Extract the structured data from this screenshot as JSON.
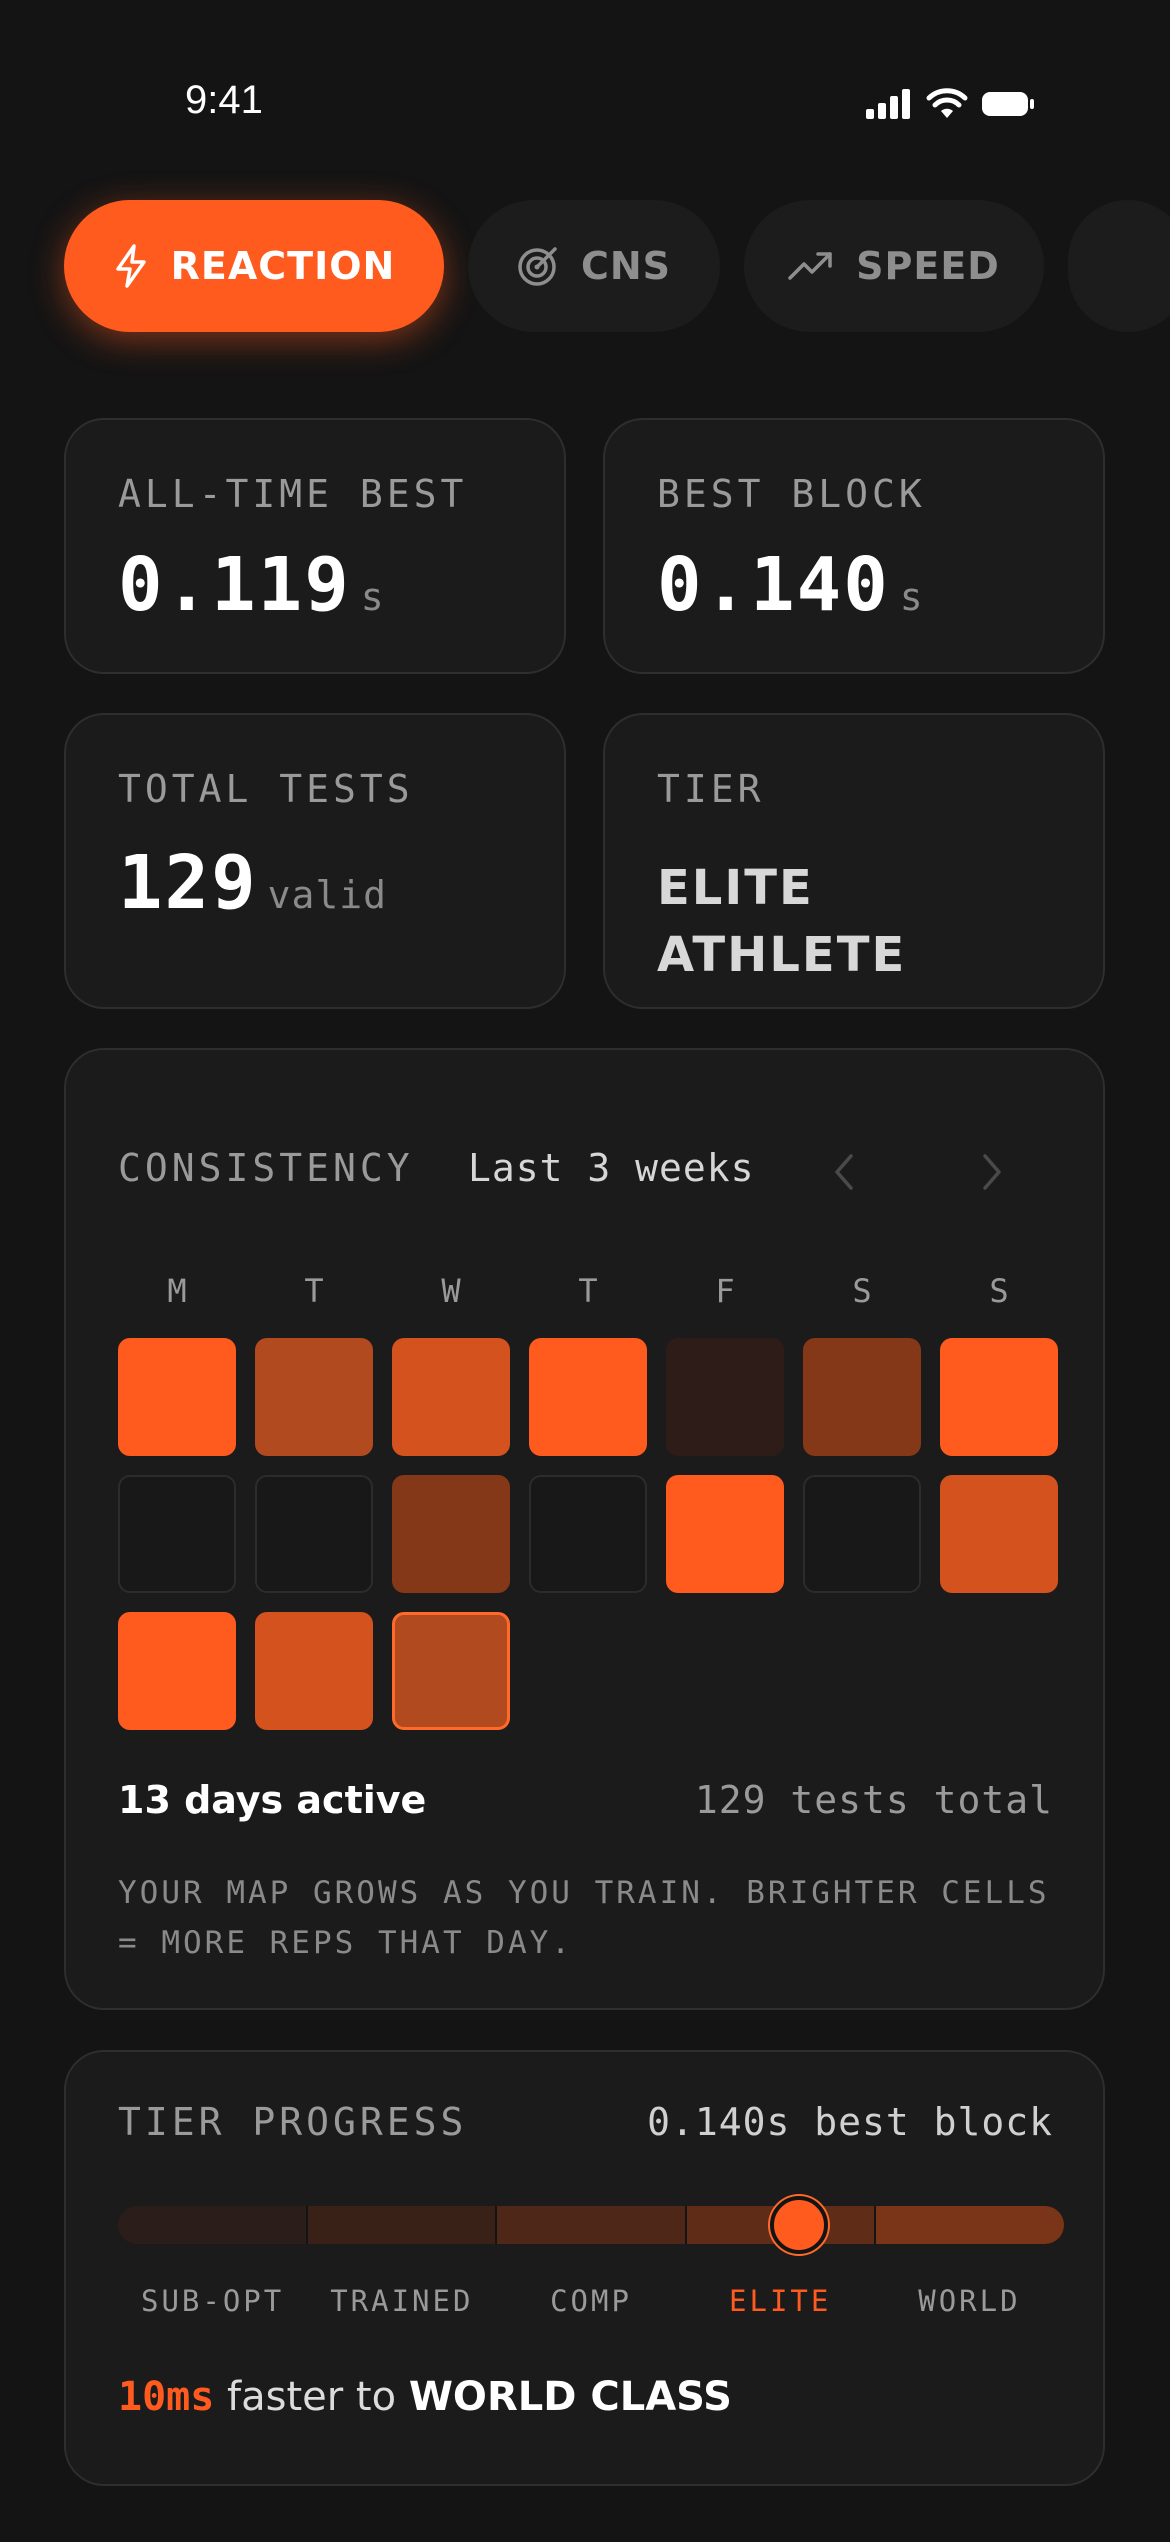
{
  "status_bar": {
    "time": "9:41"
  },
  "tabs": [
    {
      "label": "REACTION",
      "icon": "lightning-icon",
      "active": true
    },
    {
      "label": "CNS",
      "icon": "target-icon",
      "active": false
    },
    {
      "label": "SPEED",
      "icon": "trending-up-icon",
      "active": false
    }
  ],
  "stats": {
    "all_time_best": {
      "label": "ALL-TIME BEST",
      "value": "0.119",
      "unit": "s"
    },
    "best_block": {
      "label": "BEST BLOCK",
      "value": "0.140",
      "unit": "s"
    },
    "total_tests": {
      "label": "TOTAL TESTS",
      "value": "129",
      "unit": "valid"
    },
    "tier": {
      "label": "TIER",
      "line1": "ELITE",
      "line2": "ATHLETE"
    }
  },
  "consistency": {
    "title": "CONSISTENCY",
    "range": "Last 3 weeks",
    "days": [
      "M",
      "T",
      "W",
      "T",
      "F",
      "S",
      "S"
    ],
    "heat_colors": {
      "0": "#181818",
      "1": "#2d1c18",
      "2": "#843818",
      "3": "#b24a1f",
      "4": "#d4521e",
      "5": "#ff5b1f"
    },
    "weeks": [
      [
        5,
        3,
        4,
        5,
        1,
        2,
        5
      ],
      [
        0,
        0,
        2,
        0,
        5,
        0,
        4
      ],
      [
        5,
        4,
        3
      ]
    ],
    "active_days": "13 days active",
    "tests_total": "129 tests total",
    "note": "YOUR MAP GROWS AS YOU TRAIN. BRIGHTER CELLS = MORE REPS THAT DAY."
  },
  "tier_progress": {
    "title": "TIER PROGRESS",
    "best": "0.140s best block",
    "levels": [
      "SUB-OPT",
      "TRAINED",
      "COMP",
      "ELITE",
      "WORLD"
    ],
    "level_colors": [
      "#2a1d1a",
      "#3a2118",
      "#4e2718",
      "#5f2c18",
      "#7a3417"
    ],
    "active_level": "ELITE",
    "progress": 0.72,
    "footer_ms": "10ms",
    "footer_mid": " faster to ",
    "footer_goal": "WORLD CLASS"
  }
}
